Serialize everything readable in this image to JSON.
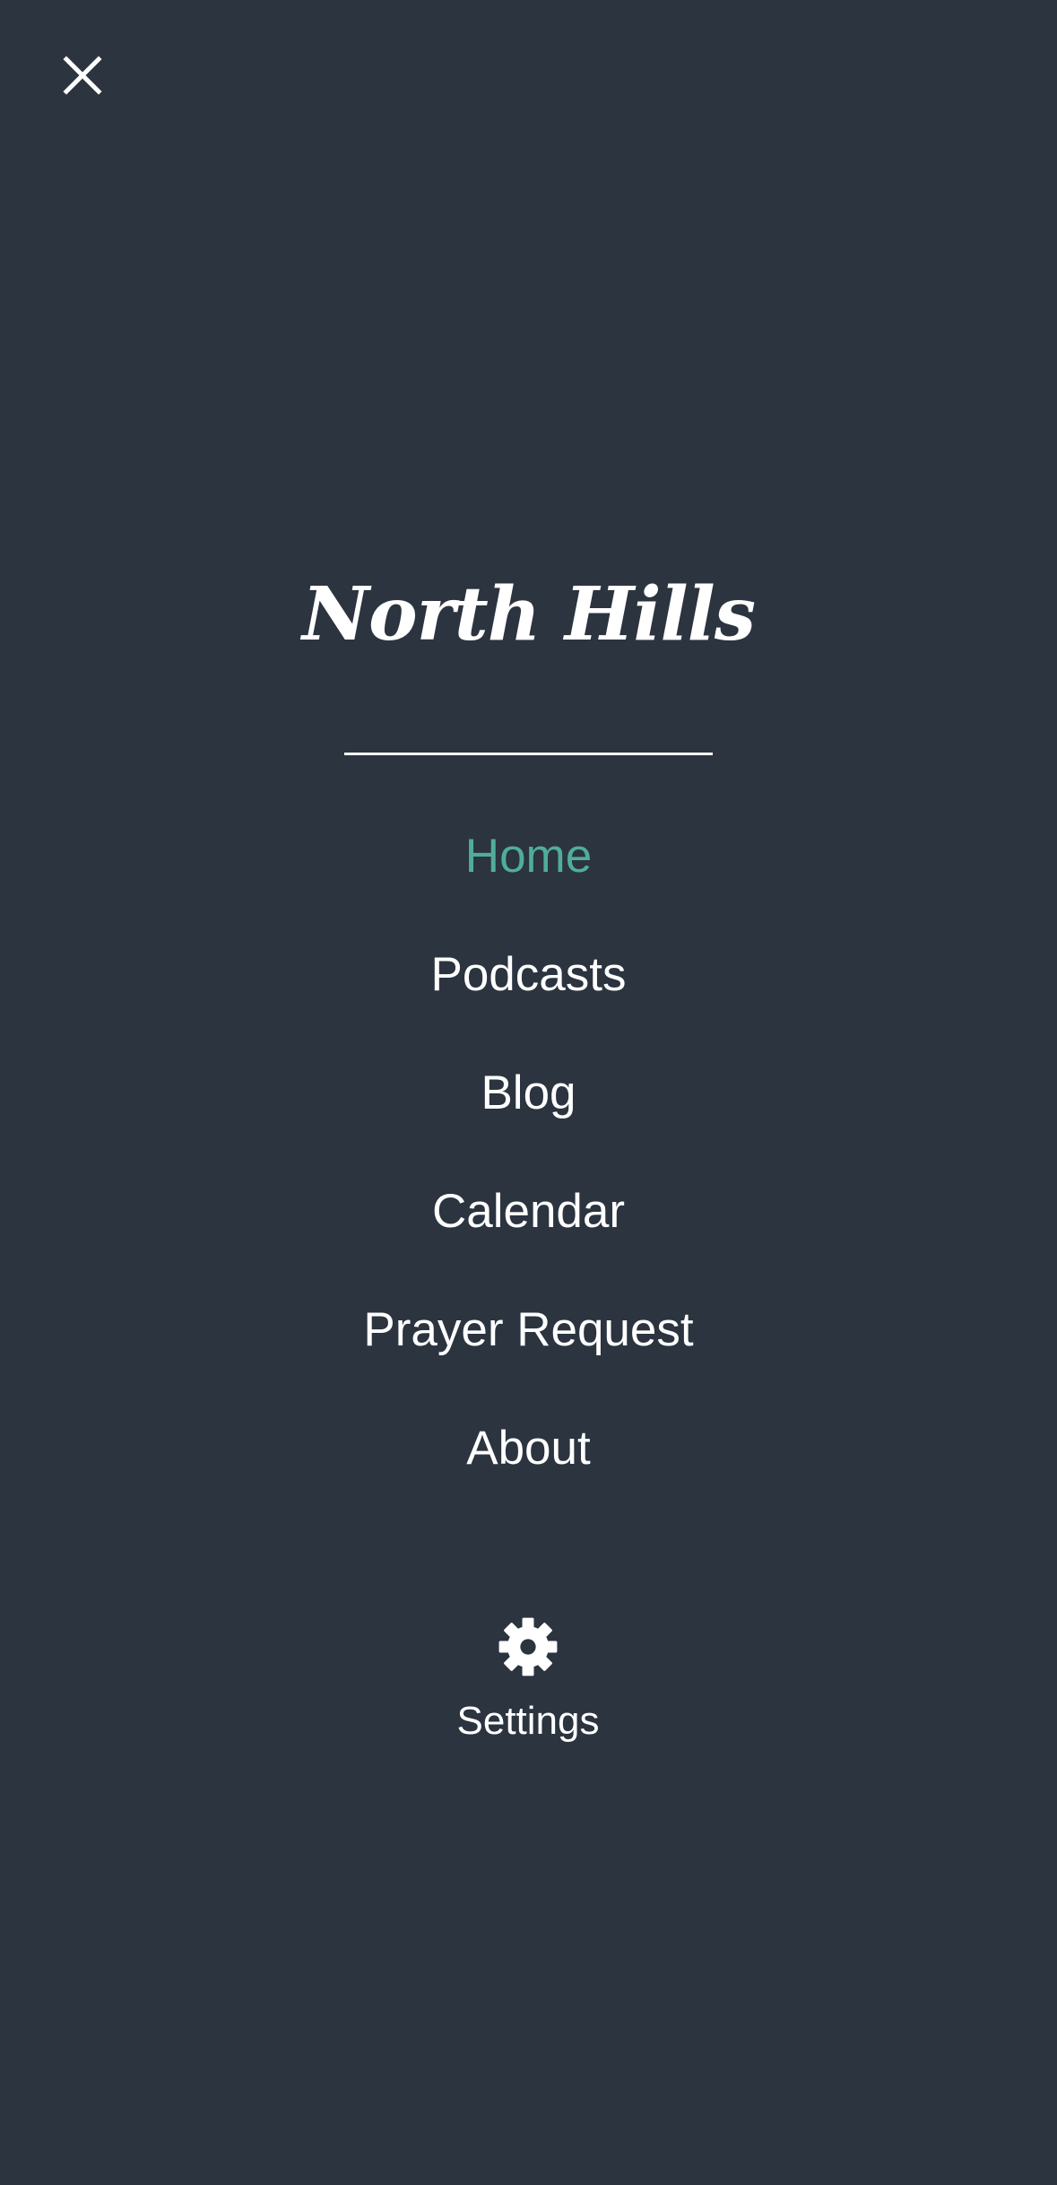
{
  "menu": {
    "close_icon": "close-icon",
    "logo_text": "North Hills",
    "items": [
      {
        "label": "Home",
        "active": true
      },
      {
        "label": "Podcasts",
        "active": false
      },
      {
        "label": "Blog",
        "active": false
      },
      {
        "label": "Calendar",
        "active": false
      },
      {
        "label": "Prayer Request",
        "active": false
      },
      {
        "label": "About",
        "active": false
      }
    ],
    "settings": {
      "icon": "gear-icon",
      "label": "Settings"
    }
  },
  "colors": {
    "background": "#2b343f",
    "text": "#ffffff",
    "active": "#4fae9b"
  }
}
